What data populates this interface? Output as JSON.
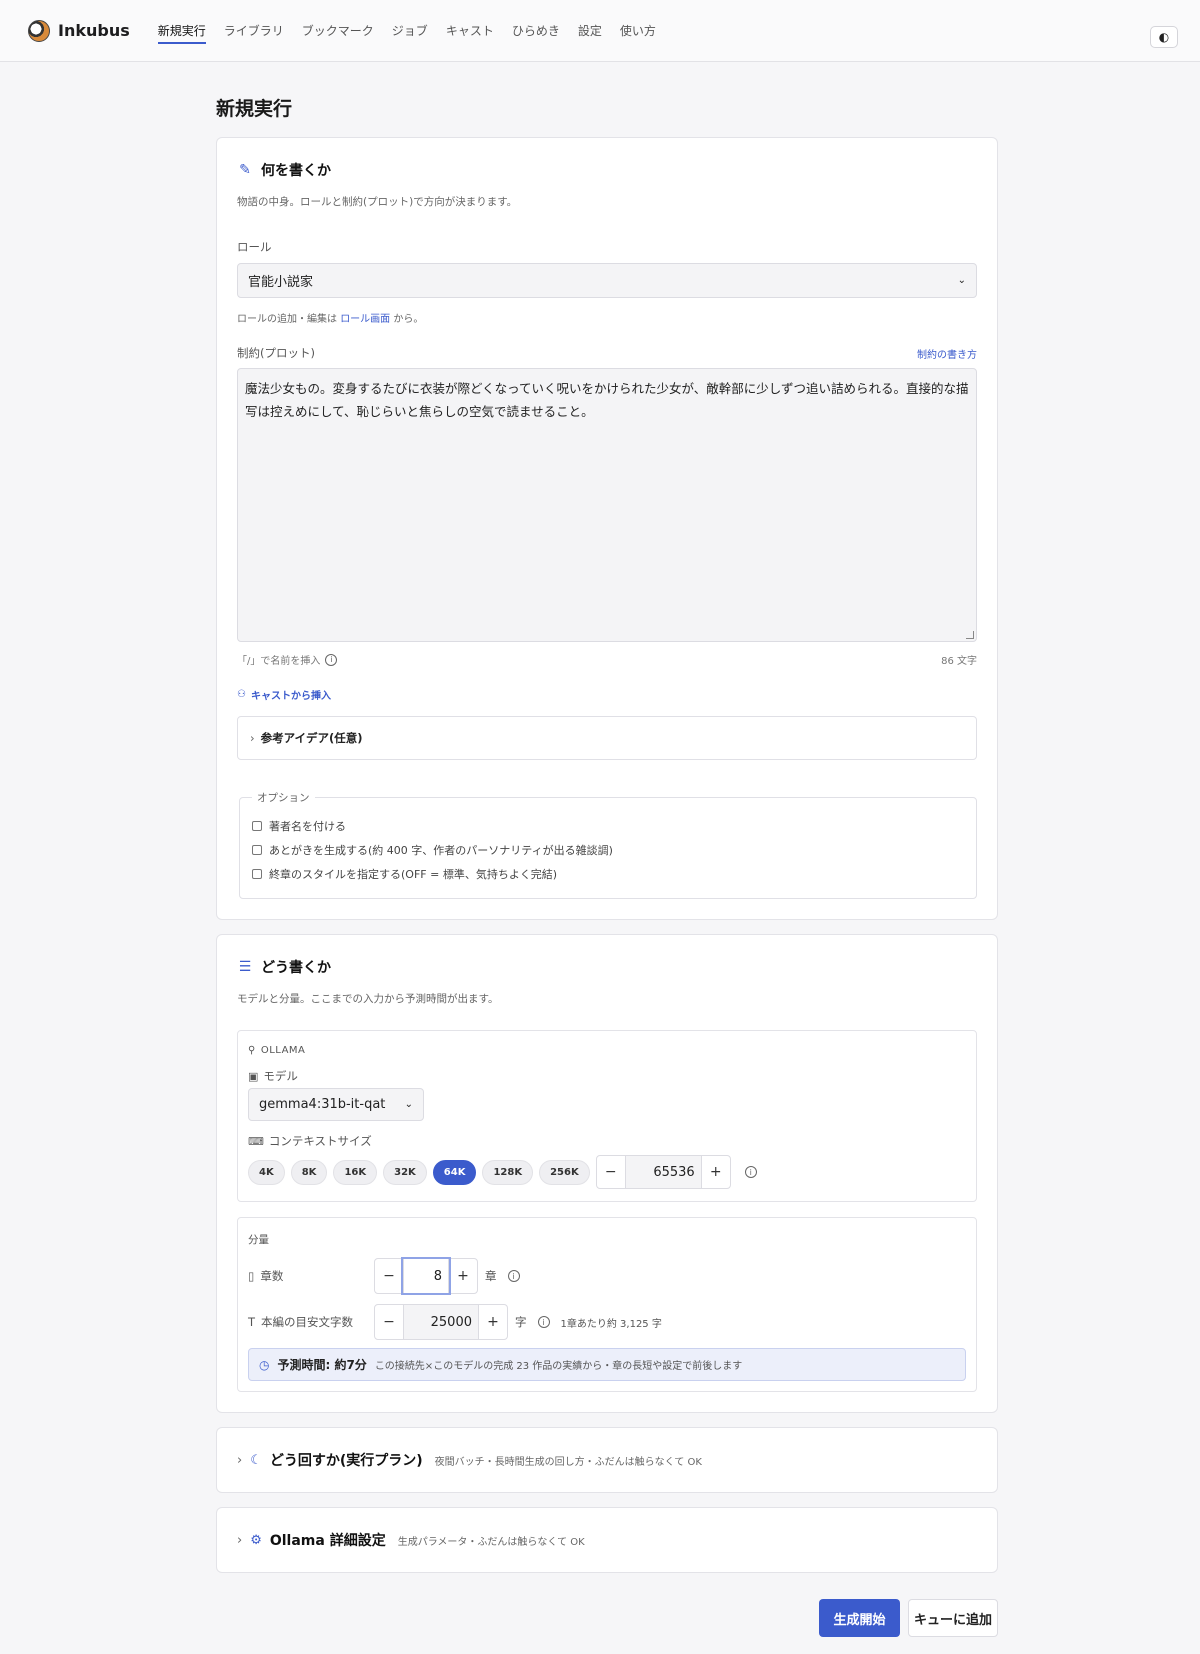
{
  "app": {
    "name": "Inkubus"
  },
  "nav": [
    "新規実行",
    "ライブラリ",
    "ブックマーク",
    "ジョブ",
    "キャスト",
    "ひらめき",
    "設定",
    "使い方"
  ],
  "page_title": "新規実行",
  "what": {
    "title": "何を書くか",
    "desc": "物語の中身。ロールと制約(プロット)で方向が決まります。",
    "role_label": "ロール",
    "role_value": "官能小説家",
    "role_hint_pre": "ロールの追加・編集は",
    "role_hint_link": "ロール画面",
    "role_hint_post": "から。",
    "constraint_label": "制約(プロット)",
    "constraint_help": "制約の書き方",
    "constraint_text": "魔法少女もの。変身するたびに衣装が際どくなっていく呪いをかけられた少女が、敵幹部に少しずつ追い詰められる。直接的な描写は控えめにして、恥じらいと焦らしの空気で読ませること。",
    "insert_hint": "「/」で名前を挿入",
    "char_count": "86 文字",
    "cast_insert": "キャストから挿入",
    "reference": "参考アイデア(任意)",
    "options_legend": "オプション",
    "options": [
      "著者名を付ける",
      "あとがきを生成する(約 400 字、作者のパーソナリティが出る雑談調)",
      "終章のスタイルを指定する(OFF = 標準、気持ちよく完結)"
    ]
  },
  "how": {
    "title": "どう書くか",
    "desc": "モデルと分量。ここまでの入力から予測時間が出ます。",
    "provider": "OLLAMA",
    "model_label": "モデル",
    "model_value": "gemma4:31b-it-qat",
    "context_label": "コンテキストサイズ",
    "context_pills": [
      "4K",
      "8K",
      "16K",
      "32K",
      "64K",
      "128K",
      "256K"
    ],
    "context_active": "64K",
    "context_value": "65536",
    "volume_label": "分量",
    "chapters_label": "章数",
    "chapters_value": "8",
    "chapters_unit": "章",
    "chars_label": "本編の目安文字数",
    "chars_value": "25000",
    "chars_unit": "字",
    "per_chapter": "1章あたり約 3,125 字",
    "estimate_strong": "予測時間: 約7分",
    "estimate_note": "この接続先×このモデルの完成 23 作品の実績から・章の長短や設定で前後します"
  },
  "plan": {
    "title": "どう回すか(実行プラン)",
    "sub": "夜間バッチ・長時間生成の回し方・ふだんは触らなくて OK"
  },
  "ollama": {
    "title": "Ollama 詳細設定",
    "sub": "生成パラメータ・ふだんは触らなくて OK"
  },
  "actions": {
    "start": "生成開始",
    "queue": "キューに追加"
  },
  "colors": {
    "accent": "#3b5bcc"
  }
}
